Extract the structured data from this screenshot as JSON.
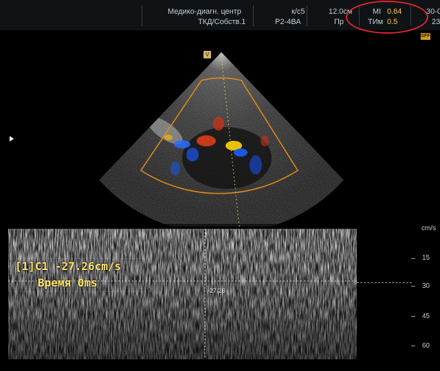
{
  "header": {
    "clinic": "Медико-диагн. центр",
    "preset": "ТКД/Собств.1",
    "probe_rate": "к/с5",
    "probe": "Р2-4ВА",
    "depth": "12.0см",
    "mode": "Пр",
    "mi_label": "MI",
    "mi_value": "0.64",
    "tim_label": "ТИм",
    "tim_value": "0.5",
    "date_fragment": "30-0",
    "time_fragment": "23"
  },
  "colors": {
    "highlight_oval": "#e0252f",
    "roi_box": "#e08a1a",
    "measurement_text": "#ffe36a"
  },
  "badges": {
    "sfff": "SFF",
    "probe_marker": "V"
  },
  "doppler": {
    "unit": "cm/s",
    "scale_labels": [
      "15",
      "30",
      "45",
      "60"
    ],
    "cursor_value": "-27.26"
  },
  "measurement": {
    "line1": "[1]C1 -27.26cm/s",
    "line2": "Время 0ms"
  }
}
